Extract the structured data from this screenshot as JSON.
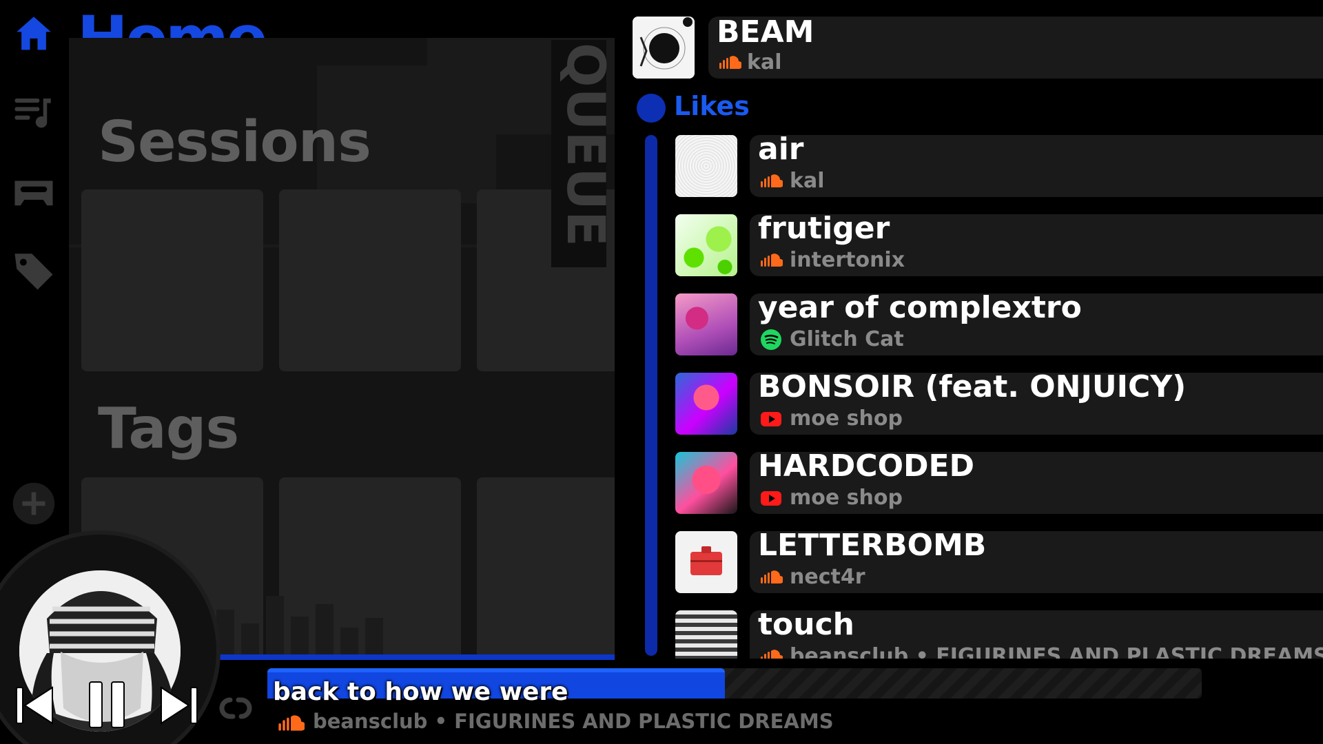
{
  "header": {
    "title": "Home"
  },
  "home": {
    "sections": [
      "Sessions",
      "Tags"
    ],
    "queue_label": "QUEUE"
  },
  "now_header": {
    "title": "BEAM",
    "artist": "kal",
    "source_icon": "soundcloud-icon"
  },
  "group": {
    "label": "Likes"
  },
  "tracks": [
    {
      "title": "air",
      "artist": "kal",
      "source": "soundcloud"
    },
    {
      "title": "frutiger",
      "artist": "intertonix",
      "source": "soundcloud"
    },
    {
      "title": "year of complextro",
      "artist": "Glitch Cat",
      "source": "spotify"
    },
    {
      "title": "BONSOIR (feat. ONJUICY)",
      "artist": "moe shop",
      "source": "youtube"
    },
    {
      "title": "HARDCODED",
      "artist": "moe shop",
      "source": "youtube"
    },
    {
      "title": "LETTERBOMB",
      "artist": "nect4r",
      "source": "soundcloud"
    },
    {
      "title": "touch",
      "artist": "beansclub • FIGURINES AND PLASTIC DREAMS",
      "source": "soundcloud"
    }
  ],
  "player": {
    "title": "back to how we were",
    "artist": "beansclub • FIGURINES AND PLASTIC DREAMS",
    "progress": 0.49
  },
  "colors": {
    "accent": "#1448e0",
    "soundcloud": "#ff6a1a",
    "spotify": "#1ed760",
    "youtube": "#ff1a1a"
  }
}
